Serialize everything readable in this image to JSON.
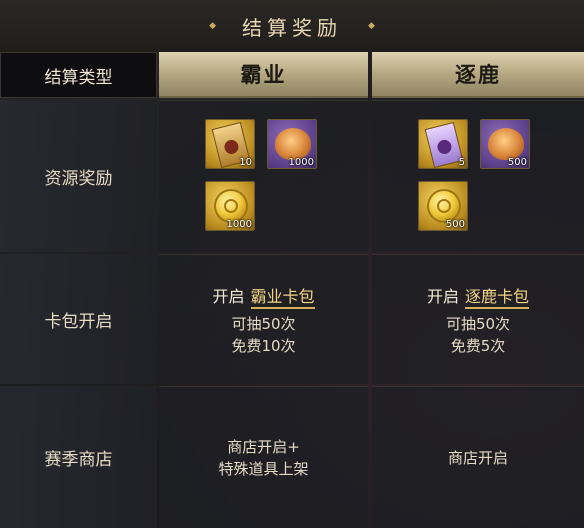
{
  "title": "结算奖励",
  "title_deco": "◆",
  "header": {
    "type_label": "结算类型",
    "col1": "霸业",
    "col2": "逐鹿"
  },
  "rows": {
    "resource": {
      "label": "资源奖励",
      "col1_items": [
        {
          "icon": "gold-token-icon",
          "count": "10"
        },
        {
          "icon": "bun-icon",
          "count": "1000"
        },
        {
          "icon": "gold-coin-icon",
          "count": "1000"
        }
      ],
      "col2_items": [
        {
          "icon": "purple-token-icon",
          "count": "5"
        },
        {
          "icon": "bun-icon",
          "count": "500"
        },
        {
          "icon": "gold-coin-icon",
          "count": "500"
        }
      ]
    },
    "pack": {
      "label": "卡包开启",
      "col1_open": "开启",
      "col1_pack": "霸业卡包",
      "col1_draw": "可抽50次",
      "col1_free": "免费10次",
      "col2_open": "开启",
      "col2_pack": "逐鹿卡包",
      "col2_draw": "可抽50次",
      "col2_free": "免费5次"
    },
    "shop": {
      "label": "赛季商店",
      "col1_line1": "商店开启+",
      "col1_line2": "特殊道具上架",
      "col2_line1": "商店开启"
    }
  }
}
